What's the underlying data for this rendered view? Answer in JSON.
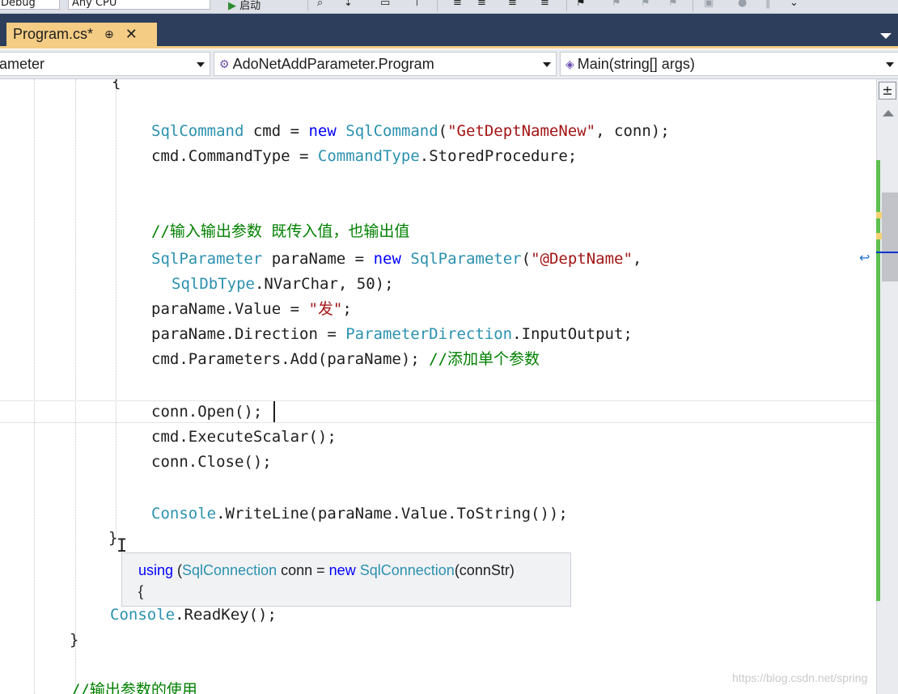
{
  "toolbar": {
    "config_value": "Debug",
    "platform_value": "Any CPU",
    "start_label": "启动"
  },
  "tab": {
    "name": "Program.cs*",
    "pin_glyph": "⊕",
    "close_glyph": "✕"
  },
  "nav": {
    "project": "ameter",
    "class": "AdoNetAddParameter.Program",
    "member": "Main(string[] args)"
  },
  "code": {
    "l_brace_top": "{",
    "l1": {
      "t1": "SqlCommand",
      "t2": " cmd = ",
      "kw": "new",
      "t3": " ",
      "t4": "SqlCommand",
      "t5": "(",
      "s": "\"GetDeptNameNew\"",
      "t6": ", conn);"
    },
    "l2": {
      "t1": "cmd.CommandType = ",
      "t2": "CommandType",
      "t3": ".StoredProcedure;"
    },
    "l3": {
      "c": "//输入输出参数 既传入值，也输出值"
    },
    "l4": {
      "t1": "SqlParameter",
      "t2": " paraName = ",
      "kw": "new",
      "t3": " ",
      "t4": "SqlParameter",
      "t5": "(",
      "s": "\"@DeptName\"",
      "t6": ","
    },
    "l5": {
      "t1": "SqlDbType",
      "t2": ".NVarChar, 50);"
    },
    "l6": {
      "t1": "paraName.Value = ",
      "s": "\"发\"",
      "t2": ";"
    },
    "l7": {
      "t1": "paraName.Direction = ",
      "t2": "ParameterDirection",
      "t3": ".InputOutput;"
    },
    "l8": {
      "t1": "cmd.Parameters.Add(paraName); ",
      "c": "//添加单个参数"
    },
    "l9": {
      "t1": "conn.Open();"
    },
    "l10": {
      "t1": "cmd.ExecuteScalar();"
    },
    "l11": {
      "t1": "conn.Close();"
    },
    "l12": {
      "t1": "Console",
      "t2": ".WriteLine(paraName.Value.ToString());"
    },
    "l13": {
      "t1": "}"
    },
    "l14": {
      "t1": "Console",
      "t2": ".ReadKey();"
    },
    "l15": {
      "t1": "}"
    },
    "l16": {
      "c": "//输出参数的使用"
    }
  },
  "tooltip": {
    "kw1": "using",
    "p1": " (",
    "type1": "SqlConnection",
    "p2": " conn = ",
    "kw2": "new",
    "p3": " ",
    "type2": "SqlConnection",
    "p4": "(connStr)",
    "line2": "{"
  },
  "watermark": "https://blog.csdn.net/spring",
  "colors": {
    "tab_strip": "#2d3e5c",
    "active_tab": "#f5cc84",
    "keyword": "#0000ff",
    "type": "#2b91af",
    "string": "#a31515",
    "comment": "#008000",
    "change_bar": "#5fbf50"
  }
}
